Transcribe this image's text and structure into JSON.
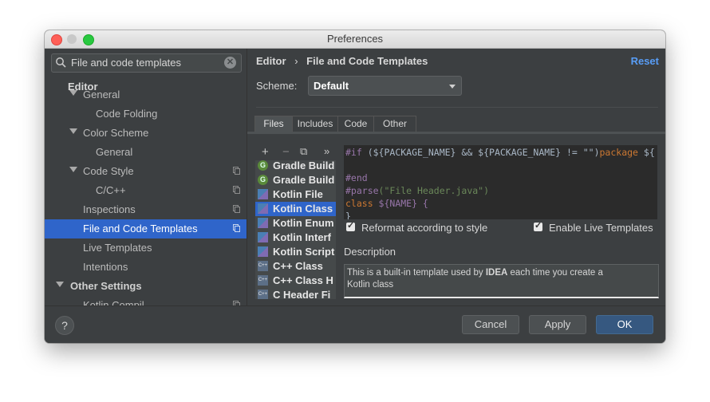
{
  "window": {
    "title": "Preferences"
  },
  "sidebar": {
    "search_value": "File and code templates",
    "section_header": "Editor",
    "items": [
      {
        "label": "General",
        "expanded": true,
        "indent": 1
      },
      {
        "label": "Code Folding",
        "indent": 2
      },
      {
        "label": "Color Scheme",
        "expanded": true,
        "indent": 1
      },
      {
        "label": "General",
        "indent": 2
      },
      {
        "label": "Code Style",
        "expanded": true,
        "indent": 1
      },
      {
        "label": "C/C++",
        "indent": 2
      },
      {
        "label": "Inspections",
        "indent": 1
      },
      {
        "label": "File and Code Templates",
        "indent": 1,
        "selected": true
      },
      {
        "label": "Live Templates",
        "indent": 1
      },
      {
        "label": "Intentions",
        "indent": 1
      },
      {
        "label": "Other Settings",
        "expanded": true,
        "indent": 0
      },
      {
        "label": "Kotlin Compil",
        "indent": 1
      }
    ]
  },
  "main": {
    "breadcrumb_parent": "Editor",
    "breadcrumb_sep": "›",
    "breadcrumb_current": "File and Code Templates",
    "reset_label": "Reset",
    "scheme_label": "Scheme:",
    "scheme_value": "Default",
    "tabs": [
      "Files",
      "Includes",
      "Code",
      "Other"
    ],
    "active_tab": "Files",
    "toolbar": {
      "add": "+",
      "remove": "−",
      "copy": "⧉",
      "more": "»"
    },
    "templates": [
      {
        "name": "Gradle Build",
        "icon": "gradle-icon"
      },
      {
        "name": "Gradle Build",
        "icon": "gradle-icon"
      },
      {
        "name": "Kotlin File",
        "icon": "kotlin-icon"
      },
      {
        "name": "Kotlin Class",
        "icon": "kotlin-icon",
        "selected": true
      },
      {
        "name": "Kotlin Enum",
        "icon": "kotlin-icon"
      },
      {
        "name": "Kotlin Interf",
        "icon": "kotlin-icon"
      },
      {
        "name": "Kotlin Script",
        "icon": "kotlin-icon"
      },
      {
        "name": "C++ Class",
        "icon": "cpp-icon"
      },
      {
        "name": "C++ Class H",
        "icon": "cpp-icon"
      },
      {
        "name": "C Header Fi",
        "icon": "cpp-icon"
      }
    ],
    "code": {
      "line1_dir": "#if",
      "line1_a": " (${PACKAGE_NAME} && ${PACKAGE_NAME} != \"\")",
      "line1_kw": "package",
      "line1_b": " ${",
      "line3": "#end",
      "line4_dir": "#parse",
      "line4_str": "(\"File Header.java\")",
      "line5_kw": "class",
      "line5_rest": " ${NAME} {",
      "line6": "}"
    },
    "reformat_label": "Reformat according to style",
    "reformat_checked": true,
    "live_templates_label": "Enable Live Templates",
    "live_templates_checked": true,
    "description_label": "Description",
    "description_pre": "This is a built-in template used by ",
    "description_bold": "IDEA",
    "description_post": " each time you create a",
    "description_line2": "Kotlin class"
  },
  "footer": {
    "help_label": "?",
    "cancel_label": "Cancel",
    "apply_label": "Apply",
    "ok_label": "OK"
  }
}
